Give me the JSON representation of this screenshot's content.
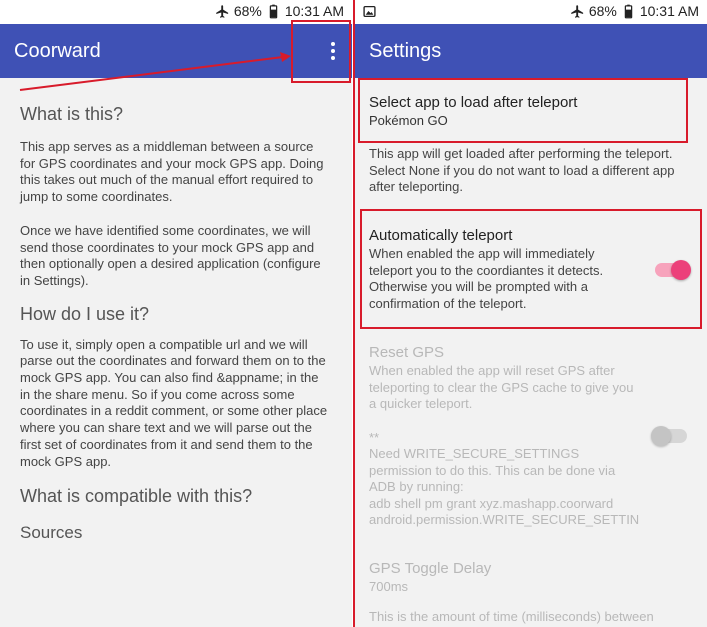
{
  "left": {
    "status": {
      "battery": "68%",
      "time": "10:31 AM"
    },
    "appbar": {
      "title": "Coorward"
    },
    "sections": {
      "what_title": "What is this?",
      "what_p1": "This app serves as a middleman between a source for GPS coordinates and your mock GPS app. Doing this takes out much of the manual effort required to jump to some coordinates.",
      "what_p2": "Once we have identified some coordinates, we will send those coordinates to your mock GPS app and then optionally open a desired application (configure in Settings).",
      "how_title": "How do I use it?",
      "how_p1": "To use it, simply open a compatible url and we will parse out the coordinates and forward them on to the mock GPS app. You can also find &appname; in the in the share menu. So if you come across some coordinates in a reddit comment, or some other place where you can share text and we will parse out the first set of coordinates from it and send them to the mock GPS app.",
      "compat_title": "What is compatible with this?",
      "sources_title": "Sources"
    }
  },
  "right": {
    "status": {
      "battery": "68%",
      "time": "10:31 AM"
    },
    "appbar": {
      "title": "Settings"
    },
    "prefs": {
      "select_app": {
        "title": "Select app to load after teleport",
        "value": "Pokémon GO",
        "desc": "This app will get loaded after performing the teleport. Select None if you do not want to load a different app after teleporting."
      },
      "auto_teleport": {
        "title": "Automatically teleport",
        "desc": "When enabled the app will immediately teleport you to the coordiantes it detects. Otherwise you will be prompted with a confirmation of the teleport.",
        "enabled": true
      },
      "reset_gps": {
        "title": "Reset GPS",
        "desc": "When enabled the app will reset GPS after teleporting to clear the GPS cache to give you a quicker teleport.",
        "note_stars": "**",
        "note": "Need WRITE_SECURE_SETTINGS permission to do this. This can be done via ADB by running:",
        "cmd1": "adb shell pm grant xyz.mashapp.coorward",
        "cmd2": "android.permission.WRITE_SECURE_SETTIN",
        "enabled": false
      },
      "gps_delay": {
        "title": "GPS Toggle Delay",
        "value": "700ms",
        "desc": "This is the amount of time (milliseconds) between"
      }
    }
  },
  "colors": {
    "primary": "#3f51b5",
    "accent": "#ec407a",
    "highlight": "#d81b2b"
  }
}
